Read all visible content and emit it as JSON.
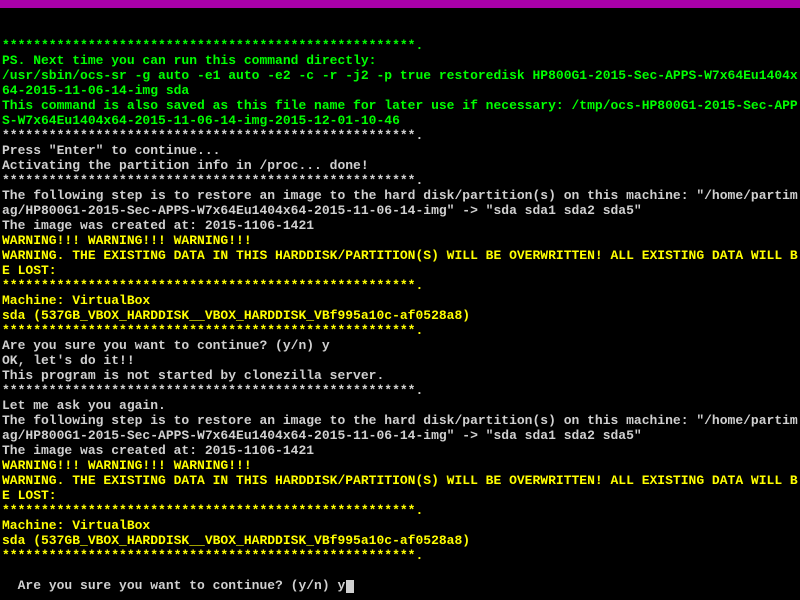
{
  "lines": [
    {
      "color": "green",
      "text": "*****************************************************."
    },
    {
      "color": "green",
      "text": "PS. Next time you can run this command directly:"
    },
    {
      "color": "green",
      "text": "/usr/sbin/ocs-sr -g auto -e1 auto -e2 -c -r -j2 -p true restoredisk HP800G1-2015-Sec-APPS-W7x64Eu1404x64-2015-11-06-14-img sda"
    },
    {
      "color": "green",
      "text": "This command is also saved as this file name for later use if necessary: /tmp/ocs-HP800G1-2015-Sec-APPS-W7x64Eu1404x64-2015-11-06-14-img-2015-12-01-10-46"
    },
    {
      "color": "white",
      "text": "*****************************************************."
    },
    {
      "color": "white",
      "text": "Press \"Enter\" to continue..."
    },
    {
      "color": "white",
      "text": "Activating the partition info in /proc... done!"
    },
    {
      "color": "white",
      "text": "*****************************************************."
    },
    {
      "color": "white",
      "text": "The following step is to restore an image to the hard disk/partition(s) on this machine: \"/home/partimag/HP800G1-2015-Sec-APPS-W7x64Eu1404x64-2015-11-06-14-img\" -> \"sda sda1 sda2 sda5\""
    },
    {
      "color": "white",
      "text": "The image was created at: 2015-1106-1421"
    },
    {
      "color": "yellow",
      "text": "WARNING!!! WARNING!!! WARNING!!!"
    },
    {
      "color": "yellow",
      "text": "WARNING. THE EXISTING DATA IN THIS HARDDISK/PARTITION(S) WILL BE OVERWRITTEN! ALL EXISTING DATA WILL BE LOST:"
    },
    {
      "color": "yellow",
      "text": "*****************************************************."
    },
    {
      "color": "yellow",
      "text": "Machine: VirtualBox"
    },
    {
      "color": "yellow",
      "text": "sda (537GB_VBOX_HARDDISK__VBOX_HARDDISK_VBf995a10c-af0528a8)"
    },
    {
      "color": "yellow",
      "text": "*****************************************************."
    },
    {
      "color": "white",
      "text": "Are you sure you want to continue? (y/n) y"
    },
    {
      "color": "white",
      "text": "OK, let's do it!!"
    },
    {
      "color": "white",
      "text": "This program is not started by clonezilla server."
    },
    {
      "color": "white",
      "text": "*****************************************************."
    },
    {
      "color": "white",
      "text": "Let me ask you again."
    },
    {
      "color": "white",
      "text": "The following step is to restore an image to the hard disk/partition(s) on this machine: \"/home/partimag/HP800G1-2015-Sec-APPS-W7x64Eu1404x64-2015-11-06-14-img\" -> \"sda sda1 sda2 sda5\""
    },
    {
      "color": "white",
      "text": "The image was created at: 2015-1106-1421"
    },
    {
      "color": "yellow",
      "text": "WARNING!!! WARNING!!! WARNING!!!"
    },
    {
      "color": "yellow",
      "text": "WARNING. THE EXISTING DATA IN THIS HARDDISK/PARTITION(S) WILL BE OVERWRITTEN! ALL EXISTING DATA WILL BE LOST:"
    },
    {
      "color": "yellow",
      "text": "*****************************************************."
    },
    {
      "color": "yellow",
      "text": "Machine: VirtualBox"
    },
    {
      "color": "yellow",
      "text": "sda (537GB_VBOX_HARDDISK__VBOX_HARDDISK_VBf995a10c-af0528a8)"
    },
    {
      "color": "yellow",
      "text": "*****************************************************."
    }
  ],
  "prompt": {
    "text": "Are you sure you want to continue? (y/n) ",
    "input": "y"
  }
}
